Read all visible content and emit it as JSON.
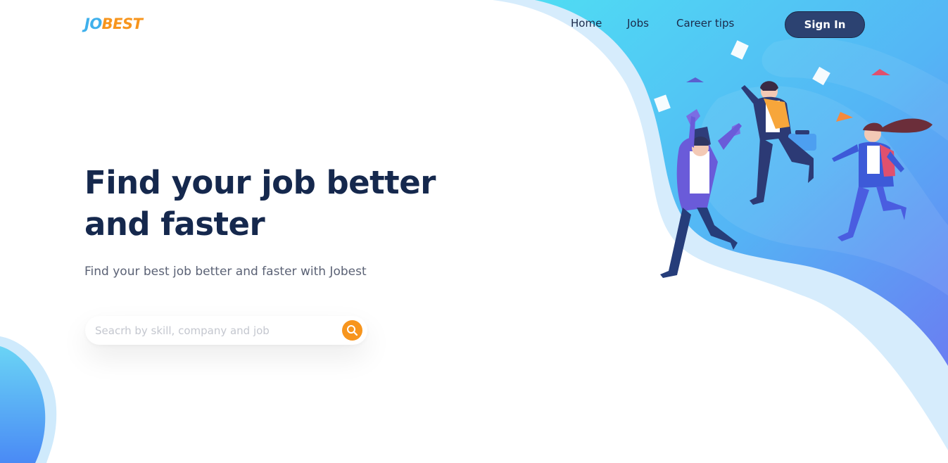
{
  "brand": {
    "logo_part1": "JO",
    "logo_part2": "BEST",
    "color_primary": "#3fb0ec",
    "color_accent": "#f7951d"
  },
  "nav": {
    "items": [
      {
        "label": "Home"
      },
      {
        "label": "Jobs"
      },
      {
        "label": "Career tips"
      }
    ],
    "signin_label": "Sign In"
  },
  "hero": {
    "title_line1": "Find your job better",
    "title_line2": "and faster",
    "subtitle": "Find your best job better and faster with Jobest"
  },
  "search": {
    "placeholder": "Seacrh by skill, company and job",
    "value": "",
    "button_icon": "search-icon"
  },
  "illustration": {
    "description_icon": "jumping-people-illustration"
  },
  "colors": {
    "heading": "#15284d",
    "signin_bg": "#2c4271",
    "wave_light": "#d9eefc",
    "wave_blue": "#4fc3f3",
    "wave_deep": "#5b8cf5"
  }
}
